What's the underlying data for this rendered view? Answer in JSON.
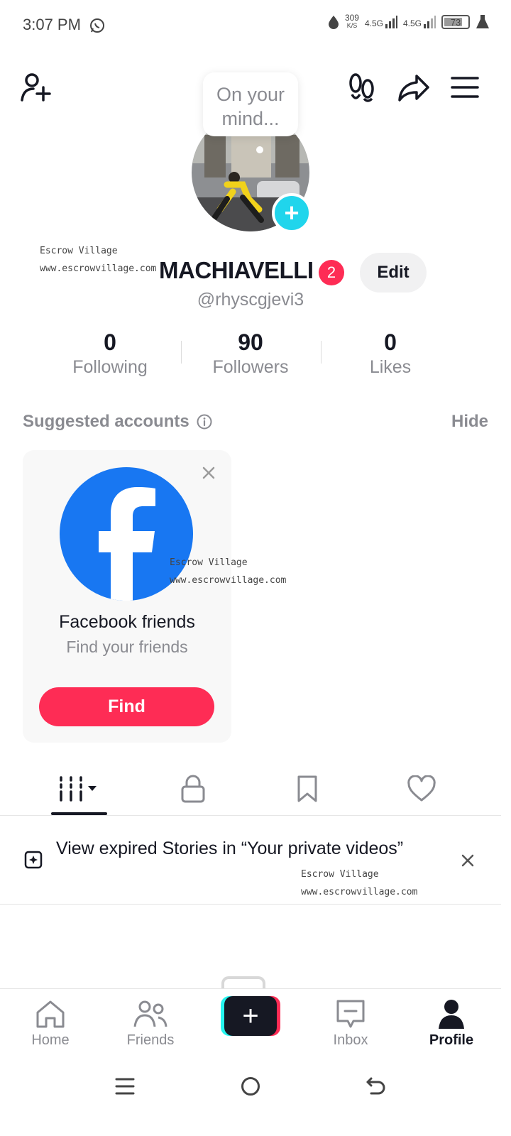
{
  "status_bar": {
    "time": "3:07 PM",
    "speed_value": "309",
    "speed_unit": "K/S",
    "net1": "4.5G",
    "net2": "4.5G",
    "battery": "73"
  },
  "header": {
    "add_friend_icon": "person-add-icon",
    "footprints_icon": "footprints-icon",
    "share_icon": "share-arrow-icon",
    "menu_icon": "hamburger-menu-icon"
  },
  "profile": {
    "mind_bubble": "On your mind...",
    "username": "MACHIAVELLI",
    "notification_count": "2",
    "edit_label": "Edit",
    "handle": "@rhyscgjevi3",
    "stats": [
      {
        "value": "0",
        "label": "Following"
      },
      {
        "value": "90",
        "label": "Followers"
      },
      {
        "value": "0",
        "label": "Likes"
      }
    ]
  },
  "suggested": {
    "title": "Suggested accounts",
    "hide_label": "Hide",
    "card": {
      "title": "Facebook friends",
      "subtitle": "Find your friends",
      "button": "Find"
    }
  },
  "notice": {
    "text": "View expired Stories in “Your private videos”"
  },
  "watermarks": [
    {
      "line1": "Escrow Village",
      "line2": "www.escrowvillage.com"
    },
    {
      "line1": "Escrow Village",
      "line2": "www.escrowvillage.com"
    },
    {
      "line1": "Escrow Village",
      "line2": "www.escrowvillage.com"
    }
  ],
  "bottom_nav": {
    "items": [
      {
        "label": "Home"
      },
      {
        "label": "Friends"
      },
      {
        "label": "Inbox"
      },
      {
        "label": "Profile"
      }
    ],
    "create_symbol": "+"
  },
  "colors": {
    "accent": "#fe2c55",
    "cyan": "#20d5ec",
    "facebook": "#1877f2"
  }
}
